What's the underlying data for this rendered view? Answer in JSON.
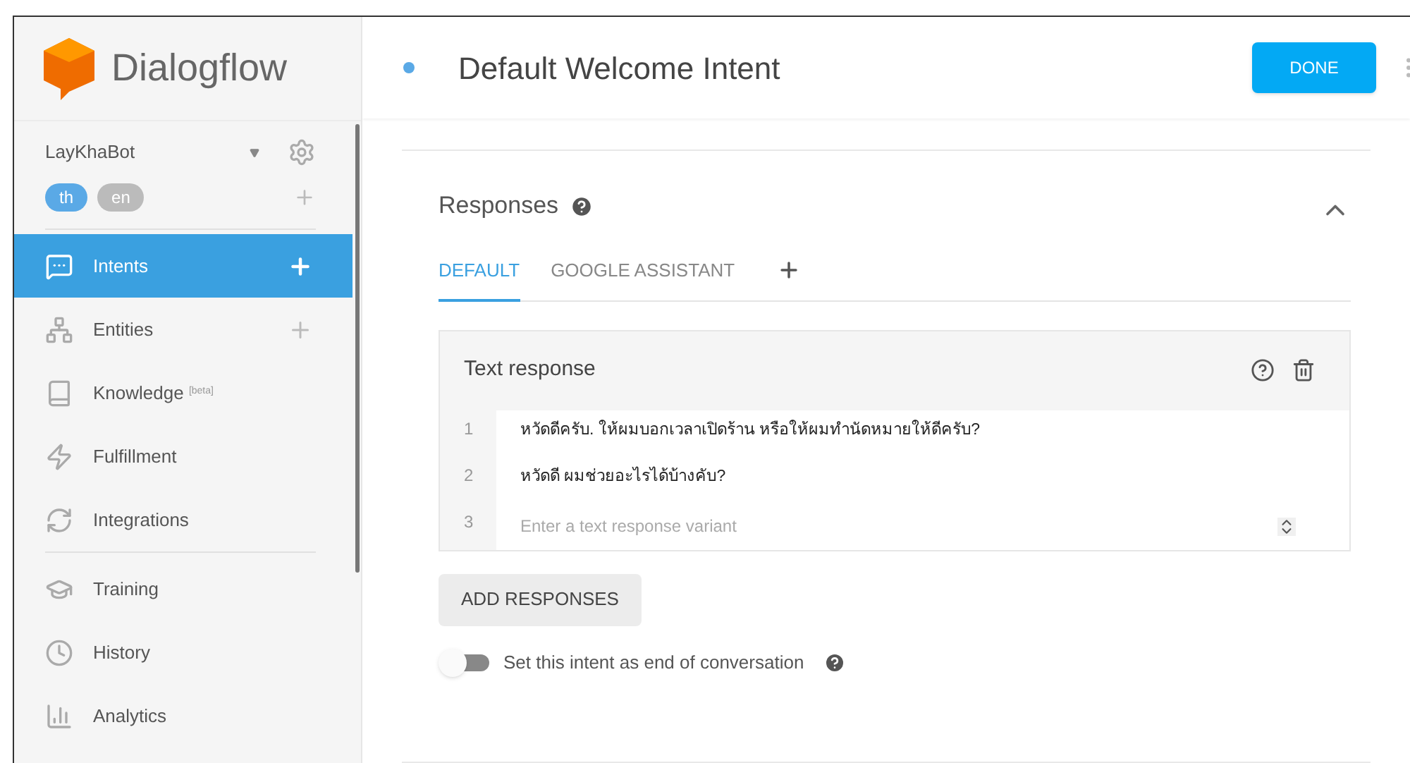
{
  "sidebar": {
    "logo": "Dialogflow",
    "agent": "LayKhaBot",
    "languages": [
      {
        "label": "th",
        "selected": true
      },
      {
        "label": "en",
        "selected": false
      }
    ],
    "nav_groups": [
      [
        {
          "label": "Intents",
          "selected": true,
          "add": true
        },
        {
          "label": "Entities",
          "selected": false,
          "add": true
        },
        {
          "label": "Knowledge $^{[beta]}$",
          "selected": false,
          "add": false
        },
        {
          "label": "Fulfillment",
          "selected": false,
          "add": false
        },
        {
          "label": "Integrations",
          "selected": false,
          "add": false
        }
      ],
      [
        {
          "label": "Training",
          "selected": false,
          "add": false
        },
        {
          "label": "History",
          "selected": false,
          "add": false
        },
        {
          "label": "Analytics",
          "selected": false,
          "add": false
        }
      ]
    ]
  },
  "header": {
    "title": "Default Welcome Intent",
    "done": "DONE"
  },
  "responses": {
    "title": "Responses",
    "expanded": true,
    "tabs": [
      {
        "label": "DEFAULT",
        "selected": true
      },
      {
        "label": "GOOGLE ASSISTANT",
        "selected": false
      }
    ],
    "card": {
      "title": "Text response",
      "rows": [
        {
          "number": "1",
          "text": "หวัดดีครับ. ให้ผมบอกเวลาเปิดร้าน หรือให้ผมทำนัดหมายให้ดีครับ?"
        },
        {
          "number": "2",
          "text": "หวัดดี ผมช่วยอะไรได้บ้างคับ?"
        },
        {
          "number": "3",
          "placeholder": "Enter a text response variant"
        }
      ]
    },
    "add_button": "ADD RESPONSES",
    "end_toggle": {
      "label": "Set this intent as end of conversation",
      "on": false
    }
  }
}
